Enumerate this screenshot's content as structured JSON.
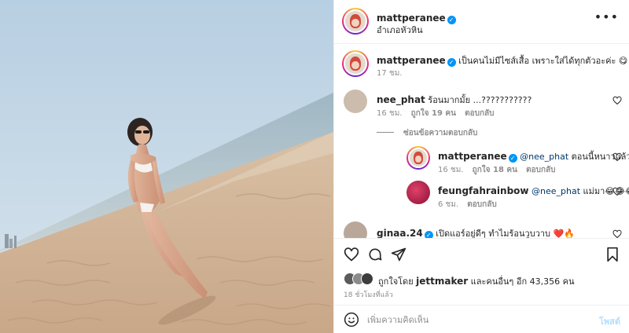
{
  "post": {
    "author": "mattperanee",
    "location": "อำเภอหัวหิน",
    "more_icon": "more-horizontal-icon"
  },
  "caption": {
    "username": "mattperanee",
    "text": "เป็นคนไม่มีไซส์เสื้อ เพราะใส่ได้ทุกตัวอะค่ะ",
    "emoji": "😋",
    "time": "17 ชม."
  },
  "comments": [
    {
      "username": "nee_phat",
      "text": "ร้อนมากมั้ย ...???????????",
      "time": "16 ชม.",
      "likes": "ถูกใจ 19 คน",
      "reply": "ตอบกลับ"
    },
    {
      "username": "mattperanee",
      "mention": "@nee_phat",
      "text": " ตอนนี้หนาวแล้วจ้า😱",
      "time": "16 ชม.",
      "likes": "ถูกใจ 18 คน",
      "reply": "ตอบกลับ"
    },
    {
      "username": "feungfahrainbow",
      "mention": "@nee_phat",
      "text": " แม่มา😂😂😂",
      "time": "6 ชม.",
      "reply": "ตอบกลับ"
    },
    {
      "username": "ginaa.24",
      "text": "เปิดแอร์อยู่ดีๆ ทำไมร้อนวูบวาบ ❤️🔥"
    }
  ],
  "hide_replies": "ซ่อนข้อความตอบกลับ",
  "likes_line": {
    "prefix": "ถูกใจโดย ",
    "user": "jettmaker",
    "suffix": " และคนอื่นๆ อีก 43,356 คน"
  },
  "timestamp": "18 ชั่วโมงที่แล้ว",
  "compose": {
    "placeholder": "เพิ่มความคิดเห็น",
    "post_label": "โพสต์",
    "emoji_icon": "smiley-icon"
  },
  "colors": {
    "accent": "#0095f6",
    "like_red": "#ed4956",
    "border": "#efefef",
    "muted": "#8e8e8e"
  }
}
